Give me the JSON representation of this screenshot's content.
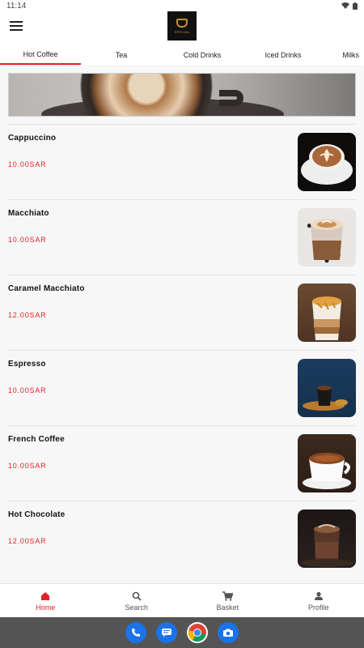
{
  "status_bar": {
    "time": "11:14"
  },
  "header": {
    "logo_text": "SPECIAL"
  },
  "tabs": [
    {
      "label": "Hot Coffee",
      "active": true
    },
    {
      "label": "Tea",
      "active": false
    },
    {
      "label": "Cold Drinks",
      "active": false
    },
    {
      "label": "Iced Drinks",
      "active": false
    },
    {
      "label": "Milks",
      "active": false
    }
  ],
  "menu_items": [
    {
      "name": "Cappuccino",
      "price": "10.00SAR",
      "image": "cappuccino-photo"
    },
    {
      "name": "Macchiato",
      "price": "10.00SAR",
      "image": "macchiato-photo"
    },
    {
      "name": "Caramel Macchiato",
      "price": "12.00SAR",
      "image": "caramel-macchiato-photo"
    },
    {
      "name": "Espresso",
      "price": "10.00SAR",
      "image": "espresso-photo"
    },
    {
      "name": "French Coffee",
      "price": "10.00SAR",
      "image": "french-coffee-photo"
    },
    {
      "name": "Hot Chocolate",
      "price": "12.00SAR",
      "image": "hot-chocolate-photo"
    }
  ],
  "bottom_nav": [
    {
      "label": "Home",
      "icon": "home-icon",
      "active": true
    },
    {
      "label": "Search",
      "icon": "search-icon",
      "active": false
    },
    {
      "label": "Basket",
      "icon": "cart-icon",
      "active": false
    },
    {
      "label": "Profile",
      "icon": "person-icon",
      "active": false
    }
  ],
  "dock_apps": [
    "phone-icon",
    "messages-icon",
    "chrome-icon",
    "camera-icon"
  ],
  "colors": {
    "accent": "#e02424",
    "price": "#e0202a",
    "dock": "#545454"
  }
}
